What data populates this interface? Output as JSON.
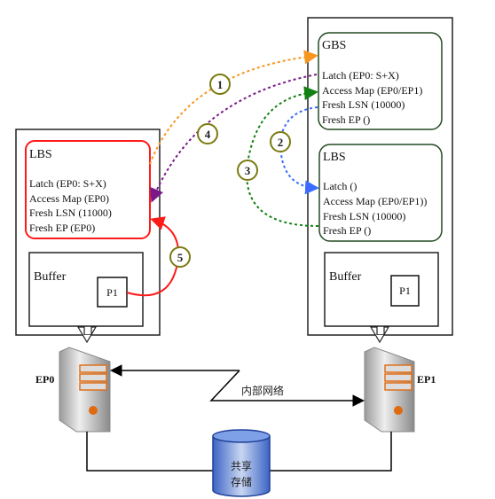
{
  "colors": {
    "step1": "#f7961e",
    "step2": "#3b6cff",
    "step3": "#138013",
    "step4": "#7a1a8a",
    "step5": "#ff1a1a",
    "step_badge": "#7a7a10",
    "storage": "#5b84d6"
  },
  "left_node": {
    "lbs": {
      "title": "LBS",
      "lines": [
        "Latch (EP0: S+X)",
        "Access Map (EP0)",
        "Fresh LSN (11000)",
        "Fresh EP (EP0)"
      ]
    },
    "buffer": {
      "title": "Buffer",
      "page": "P1"
    },
    "server_label": "EP0"
  },
  "right_node": {
    "gbs": {
      "title": "GBS",
      "lines": [
        "Latch (EP0: S+X)",
        "Access Map (EP0/EP1)",
        "Fresh LSN (10000)",
        "Fresh EP ()"
      ]
    },
    "lbs": {
      "title": "LBS",
      "lines": [
        "Latch ()",
        "Access Map (EP0/EP1))",
        "Fresh LSN (10000)",
        "Fresh EP ()"
      ]
    },
    "buffer": {
      "title": "Buffer",
      "page": "P1"
    },
    "server_label": "EP1"
  },
  "steps": [
    "1",
    "2",
    "3",
    "4",
    "5"
  ],
  "network_label": "内部网络",
  "storage": {
    "line1": "共享",
    "line2": "存储"
  }
}
